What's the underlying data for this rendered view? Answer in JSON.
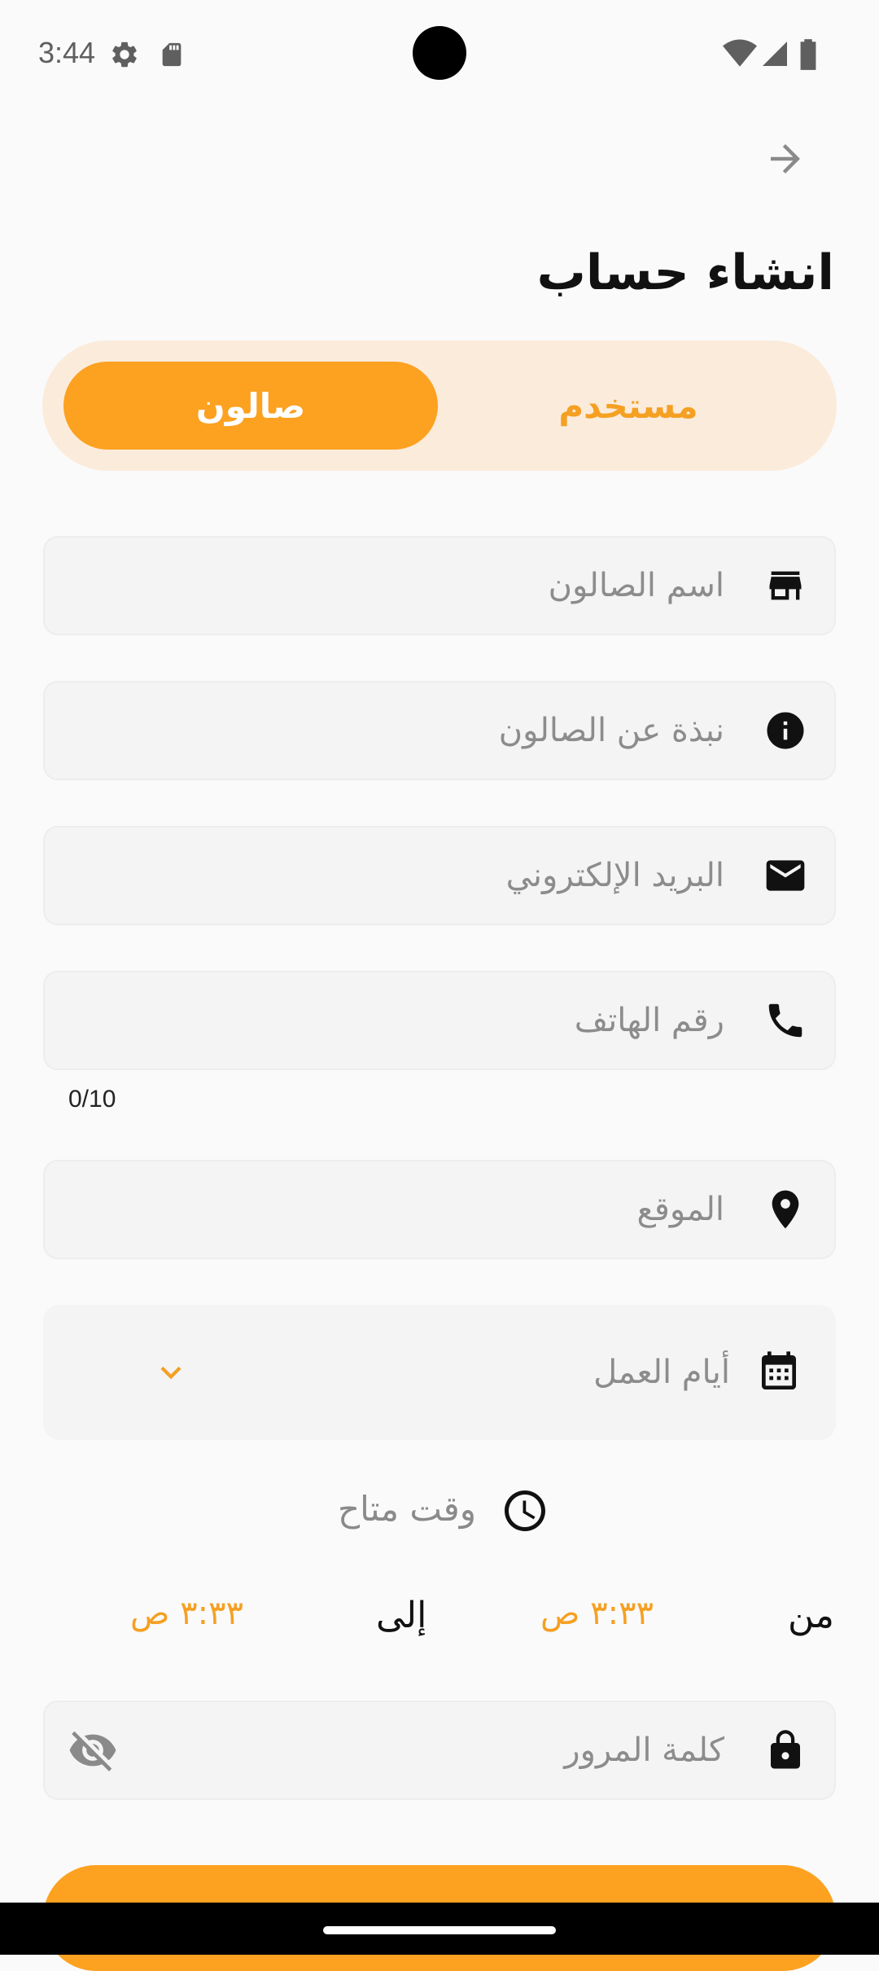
{
  "status_bar": {
    "time": "3:44"
  },
  "header": {
    "title": "انشاء حساب"
  },
  "account_type": {
    "user_label": "مستخدم",
    "salon_label": "صالون",
    "selected": "صالون"
  },
  "fields": {
    "salon_name": "اسم الصالون",
    "about": "نبذة عن الصالون",
    "email": "البريد الإلكتروني",
    "phone": "رقم الهاتف",
    "phone_counter": "0/10",
    "location": "الموقع",
    "work_days": "أيام العمل",
    "password": "كلمة المرور"
  },
  "availability": {
    "label": "وقت متاح",
    "from_label": "من",
    "from_value": "٣:٣٣ ص",
    "to_label": "إلى",
    "to_value": "٣:٣٣ ص"
  },
  "colors": {
    "accent": "#fca120",
    "segment_bg": "#fbebdb",
    "field_bg": "#f4f4f4"
  },
  "icons": {
    "back": "arrow-right-icon",
    "salon_name": "store-icon",
    "about": "info-icon",
    "email": "mail-icon",
    "phone": "phone-icon",
    "location": "location-pin-icon",
    "work_days": "calendar-icon",
    "dropdown": "chevron-down-icon",
    "time": "clock-icon",
    "password": "lock-icon",
    "toggle_visibility": "eye-off-icon"
  }
}
